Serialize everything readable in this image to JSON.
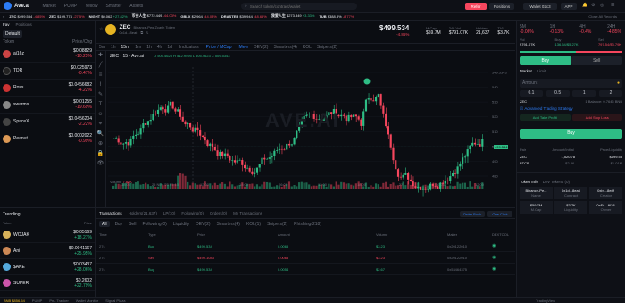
{
  "header": {
    "logo": "Ave.ai",
    "nav": [
      "Market",
      "PUMP",
      "Yellow",
      "Smarter",
      "Assets"
    ],
    "search_placeholder": "Search token/contract/wallet",
    "refer": "Refer",
    "positions": "Positions",
    "wallet": "Wallet 02c3",
    "app": "APP"
  },
  "ticker": [
    {
      "sym": "ZEC",
      "price": "$499.534",
      "chg": "-4.85%",
      "dir": "dn"
    },
    {
      "sym": "ZEC",
      "price": "$199.774",
      "chg": "-27.5%",
      "dir": "dn"
    },
    {
      "sym": "NIGHT",
      "price": "$0.062",
      "chg": "+27.82%",
      "dir": "up"
    },
    {
      "sym": "币安人生",
      "price": "$772.449",
      "chg": "-44.03%",
      "dir": "dn"
    },
    {
      "sym": "GBLX",
      "price": "$2.964",
      "chg": "-44.03%",
      "dir": "dn"
    },
    {
      "sym": "DRASTER",
      "price": "$39.944",
      "chg": "-48.65%",
      "dir": "dn"
    },
    {
      "sym": "我爱人生",
      "price": "$273.349",
      "chg": "+3.33%",
      "dir": "up"
    },
    {
      "sym": "TUB",
      "price": "$388.8%",
      "chg": "-8.77%",
      "dir": "dn"
    }
  ],
  "ticker_close": "Close All Records",
  "token": {
    "name": "ZEC",
    "sub": "Binance-Peg Zcash Token",
    "addr": "0x1d...8ea6",
    "price": "$499.534",
    "chg": "-4.85%",
    "stats": [
      {
        "label": "M.Cap",
        "value": "$59.7M"
      },
      {
        "label": "24h Vol",
        "value": "$791.07K"
      },
      {
        "label": "Holders",
        "value": "21,637"
      },
      {
        "label": "TVL",
        "value": "$3.7K"
      }
    ]
  },
  "left": {
    "tabs": [
      "Fav",
      "Positions"
    ],
    "default": "Default",
    "col_token": "Token",
    "col_price": "Price/Chg",
    "tokens": [
      {
        "name": "ai16z",
        "price": "$0.08829",
        "chg": "-10.25%",
        "dir": "dn",
        "color": "#c44"
      },
      {
        "name": "TDR",
        "price": "$0.025973",
        "chg": "-0.47%",
        "dir": "dn",
        "color": "#222"
      },
      {
        "name": "Ross",
        "price": "$0.0456682",
        "chg": "-4.22%",
        "dir": "dn",
        "color": "#c33"
      },
      {
        "name": "swarms",
        "price": "$0.01255",
        "chg": "-19.69%",
        "dir": "dn",
        "color": "#888"
      },
      {
        "name": "SpaceX",
        "price": "$0.0456204",
        "chg": "-2.22%",
        "dir": "dn",
        "color": "#444"
      },
      {
        "name": "Peanut",
        "price": "$0.0002022",
        "chg": "-0.99%",
        "dir": "dn",
        "color": "#d95"
      }
    ]
  },
  "chart": {
    "toolbar": [
      "5m",
      "1h",
      "15m",
      "1m",
      "1h",
      "4h",
      "1d",
      "Indicators",
      "Price / MCap",
      "Mew",
      "DEV(2)",
      "Smarters(4)",
      "KOL",
      "Snipers(2)"
    ],
    "title": "ZEC · 15 · Ave.ai",
    "ohlc": "O 506.4623 H 512.9495 L 505.4623 C 509.5343",
    "price_tag": "499.534",
    "volume_label": "Volume",
    "volume_val": "7.82K",
    "watermark": "AVE.AI",
    "time_labels": [
      "18:00",
      "25 Nov '25 05:15",
      "12:00",
      "18:00",
      "06:00",
      "12:00",
      "18:00",
      "27",
      "06:00",
      "12:00"
    ],
    "y_labels": [
      "549.3343",
      "540",
      "530",
      "520",
      "510",
      "500",
      "490",
      "480"
    ]
  },
  "right": {
    "periods": [
      "5M",
      "1H",
      "4H",
      "24H"
    ],
    "changes": [
      {
        "v": "-0.06%",
        "d": "dn"
      },
      {
        "v": "-0.13%",
        "d": "dn"
      },
      {
        "v": "-0.4%",
        "d": "dn"
      },
      {
        "v": "-4.85%",
        "d": "dn"
      }
    ],
    "vol": [
      {
        "label": "Vol",
        "value": "$791.07K"
      },
      {
        "label": "Buy",
        "value": "136.54/$5.27K"
      },
      {
        "label": "Sell",
        "value": "797.54/$3.79K"
      }
    ],
    "buy": "Buy",
    "sell": "Sell",
    "order_tabs": [
      "Market",
      "Limit"
    ],
    "amount": "Amount",
    "bnb_balance": "0.7646",
    "quick": [
      "0.1",
      "0.5",
      "1",
      "2"
    ],
    "receive": "ZEC",
    "receive_val": "1 Balance: 0.7646 BNB",
    "strategy": "Advanced Trading Strategy",
    "tp": "Add Take Profit",
    "sl": "Add Stop Loss",
    "buy_btn": "Buy",
    "table_head": [
      "Pair",
      "Amount/Initial",
      "Price/Liquidity"
    ],
    "pairs": [
      {
        "pair": "ZEC",
        "amt": "1,520.78",
        "price": "$499.53"
      },
      {
        "pair": "BTCB",
        "amt": "$2.36",
        "price": "$1.01M"
      }
    ],
    "info_title": "Token Info",
    "dev_tokens": "Dev Tokens (0)",
    "info_cells": [
      {
        "v": "Binance-Pe...",
        "l": "Name"
      },
      {
        "v": "0x1d...8ea6",
        "l": "Contract"
      },
      {
        "v": "0xbf...8edf",
        "l": "Creator"
      },
      {
        "v": "$59.7M",
        "l": "M.Cap"
      },
      {
        "v": "$3.7K",
        "l": "Liquidity"
      },
      {
        "v": "0xFA...f638",
        "l": "Owner"
      }
    ]
  },
  "trending": {
    "title": "Trending",
    "cols": [
      "Token",
      "Price"
    ],
    "items": [
      {
        "name": "WOJAK",
        "price": "$0.05169",
        "chg": "+18.27%",
        "color": "#d7b25b"
      },
      {
        "name": "Ani",
        "price": "$0.0041167",
        "chg": "+25.95%",
        "color": "#c85"
      },
      {
        "name": "$AKE",
        "price": "$0.03437",
        "chg": "+28.06%",
        "color": "#5ad"
      },
      {
        "name": "SUPER",
        "price": "$0.2602",
        "chg": "+22.79%",
        "color": "#c5a"
      }
    ]
  },
  "txs": {
    "tabs": [
      "Transactions",
      "Holders(21,637)",
      "LP(10)",
      "Following(0)",
      "Orders(0)",
      "My Transactions"
    ],
    "filters": [
      "All",
      "Buy",
      "Sell",
      "Following(0)",
      "Liquidity",
      "DEV(2)",
      "Smarters(4)",
      "KOL(1)",
      "Snipers(2)",
      "Phishing(218)"
    ],
    "order_book": "Order Book",
    "one_click": "One Click",
    "cols": [
      "Time",
      "Type",
      "Price",
      "Amount",
      "Volume",
      "Maker",
      "DEXTOOL"
    ],
    "rows": [
      {
        "time": "27s",
        "type": "Buy",
        "price": "$499.534",
        "amt": "0.0065",
        "vol": "$3.23",
        "maker": "0x20122010"
      },
      {
        "time": "27s",
        "type": "Sell",
        "price": "$499.1083",
        "amt": "0.0065",
        "vol": "$3.23",
        "maker": "0x20122010"
      },
      {
        "time": "27s",
        "type": "Buy",
        "price": "$499.534",
        "amt": "0.0054",
        "vol": "$2.67",
        "maker": "0x53464375"
      }
    ]
  },
  "bottom": [
    "BNB $856.54",
    "PUMP",
    "PnL Tracker",
    "Wallet Monitor",
    "Signal Plaza",
    "TradingView"
  ]
}
